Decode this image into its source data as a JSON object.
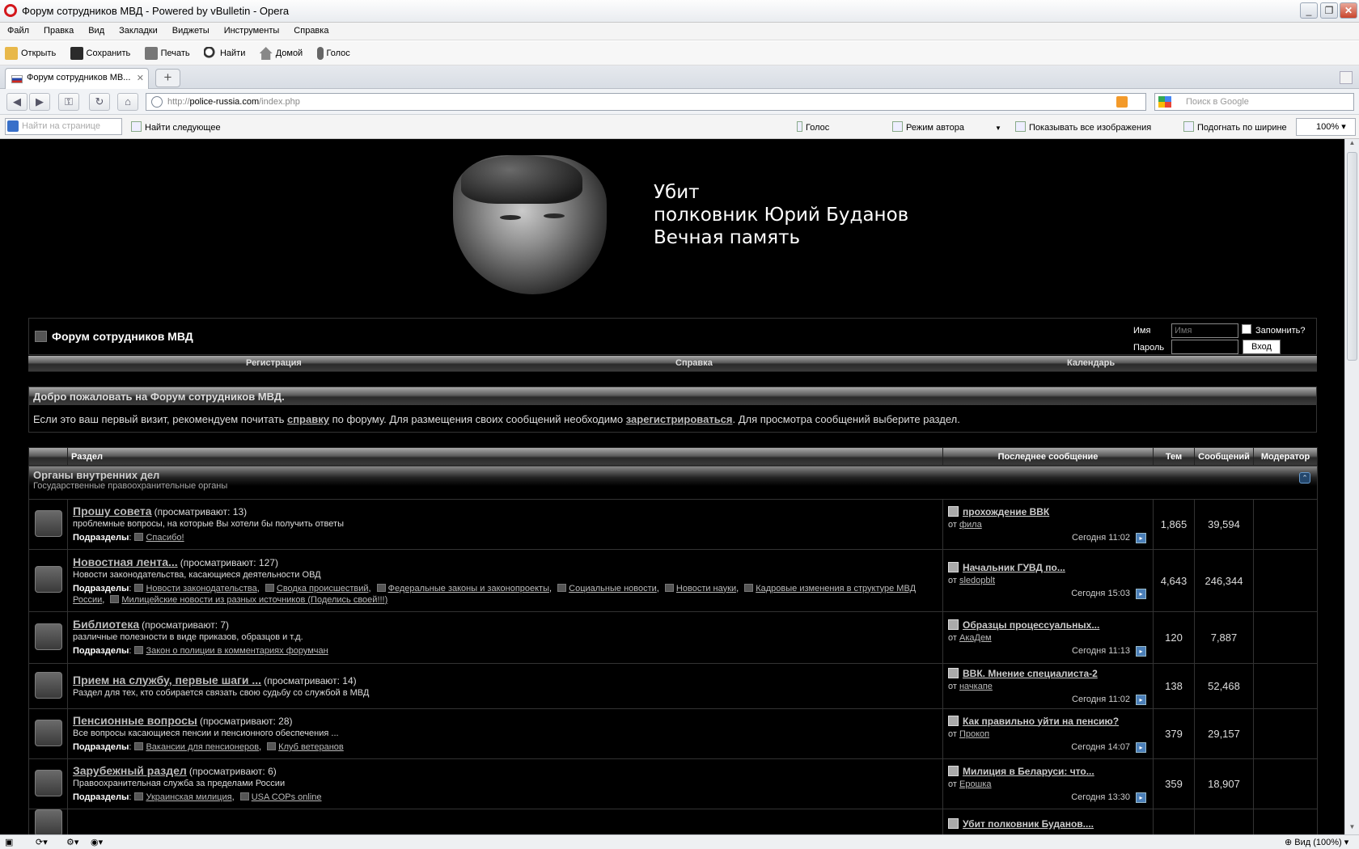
{
  "window": {
    "title": "Форум сотрудников МВД - Powered by vBulletin - Opera"
  },
  "menu": [
    "Файл",
    "Правка",
    "Вид",
    "Закладки",
    "Виджеты",
    "Инструменты",
    "Справка"
  ],
  "toolbar": {
    "open": "Открыть",
    "save": "Сохранить",
    "print": "Печать",
    "find": "Найти",
    "home": "Домой",
    "voice": "Голос"
  },
  "tab": {
    "title": "Форум сотрудников МВ..."
  },
  "address": {
    "prefix": "http://",
    "host": "police-russia.com",
    "path": "/index.php",
    "search_placeholder": "Поиск в Google"
  },
  "findbar": {
    "placeholder": "Найти на странице",
    "find_next": "Найти следующее",
    "voice": "Голос",
    "author_mode": "Режим автора",
    "show_images": "Показывать все изображения",
    "fit_width": "Подогнать по ширине",
    "zoom": "100%"
  },
  "banner": {
    "line1": "Убит",
    "line2": "полковник Юрий Буданов",
    "line3": "Вечная память"
  },
  "forum": {
    "title": "Форум сотрудников МВД",
    "login": {
      "name_label": "Имя",
      "name_placeholder": "Имя",
      "password_label": "Пароль",
      "remember": "Запомнить?",
      "submit": "Вход"
    },
    "nav": {
      "register": "Регистрация",
      "help": "Справка",
      "calendar": "Календарь"
    },
    "welcome": {
      "title": "Добро пожаловать на Форум сотрудников МВД.",
      "text1": "Если это ваш первый визит, рекомендуем почитать ",
      "link1": "справку",
      "text2": " по форуму. Для размещения своих сообщений необходимо ",
      "link2": "зарегистрироваться",
      "text3": ". Для просмотра сообщений выберите раздел."
    },
    "columns": {
      "section": "Раздел",
      "last_post": "Последнее сообщение",
      "threads": "Тем",
      "posts": "Сообщений",
      "moderator": "Модератор"
    },
    "category": {
      "title": "Органы внутренних дел",
      "subtitle": "Государственные правоохранительные органы"
    },
    "subforums_label": "Подразделы",
    "by_label": "от",
    "rows": [
      {
        "name": "Прошу совета",
        "views": "(просматривают: 13)",
        "desc": "проблемные вопросы, на которые Вы хотели бы получить ответы",
        "subs": [
          "Спасибо!"
        ],
        "last_title": "прохождение ВВК",
        "last_by": "фила",
        "last_day": "Сегодня",
        "last_time": "11:02",
        "threads": "1,865",
        "posts": "39,594"
      },
      {
        "name": "Новостная лента...",
        "views": "(просматривают: 127)",
        "desc": "Новости законодательства, касающиеся деятельности ОВД",
        "subs": [
          "Новости законодательства",
          "Сводка происшествий",
          "Федеральные законы и законопроекты",
          "Социальные новости",
          "Новости науки",
          "Кадровые изменения в структуре МВД России",
          "Милицейские новости из разных источников (Поделись своей!!!)"
        ],
        "last_title": "Начальник ГУВД по...",
        "last_by": "sledopblt",
        "last_day": "Сегодня",
        "last_time": "15:03",
        "threads": "4,643",
        "posts": "246,344"
      },
      {
        "name": "Библиотека",
        "views": "(просматривают: 7)",
        "desc": "различные полезности в виде приказов, образцов и т.д.",
        "subs": [
          "Закон о полиции в комментариях форумчан"
        ],
        "last_title": "Образцы процессуальных...",
        "last_by": "АкаДем",
        "last_day": "Сегодня",
        "last_time": "11:13",
        "threads": "120",
        "posts": "7,887"
      },
      {
        "name": "Прием на службу, первые шаги ...",
        "views": "(просматривают: 14)",
        "desc": "Раздел для тех, кто собирается связать свою судьбу со службой в МВД",
        "subs": [],
        "last_title": "ВВК. Мнение специалиста-2",
        "last_by": "начкапе",
        "last_day": "Сегодня",
        "last_time": "11:02",
        "threads": "138",
        "posts": "52,468"
      },
      {
        "name": "Пенсионные вопросы",
        "views": "(просматривают: 28)",
        "desc": "Все вопросы касающиеся пенсии и пенсионного обеспечения ...",
        "subs": [
          "Вакансии для пенсионеров",
          "Клуб ветеранов"
        ],
        "last_title": "Как правильно уйти на пенсию?",
        "last_by": "Прокоп",
        "last_day": "Сегодня",
        "last_time": "14:07",
        "threads": "379",
        "posts": "29,157"
      },
      {
        "name": "Зарубежный раздел",
        "views": "(просматривают: 6)",
        "desc": "Правоохранительная служба за пределами России",
        "subs": [
          "Украинская милиция",
          "USA COPs online"
        ],
        "last_title": "Милиция в Беларуси: что...",
        "last_by": "Ерошка",
        "last_day": "Сегодня",
        "last_time": "13:30",
        "threads": "359",
        "posts": "18,907"
      },
      {
        "name": "",
        "views": "",
        "desc": "",
        "subs": [],
        "last_title": "Убит полковник Буданов....",
        "last_by": "",
        "last_day": "",
        "last_time": "",
        "threads": "",
        "posts": ""
      }
    ]
  },
  "statusbar": {
    "zoom": "Вид (100%)"
  }
}
